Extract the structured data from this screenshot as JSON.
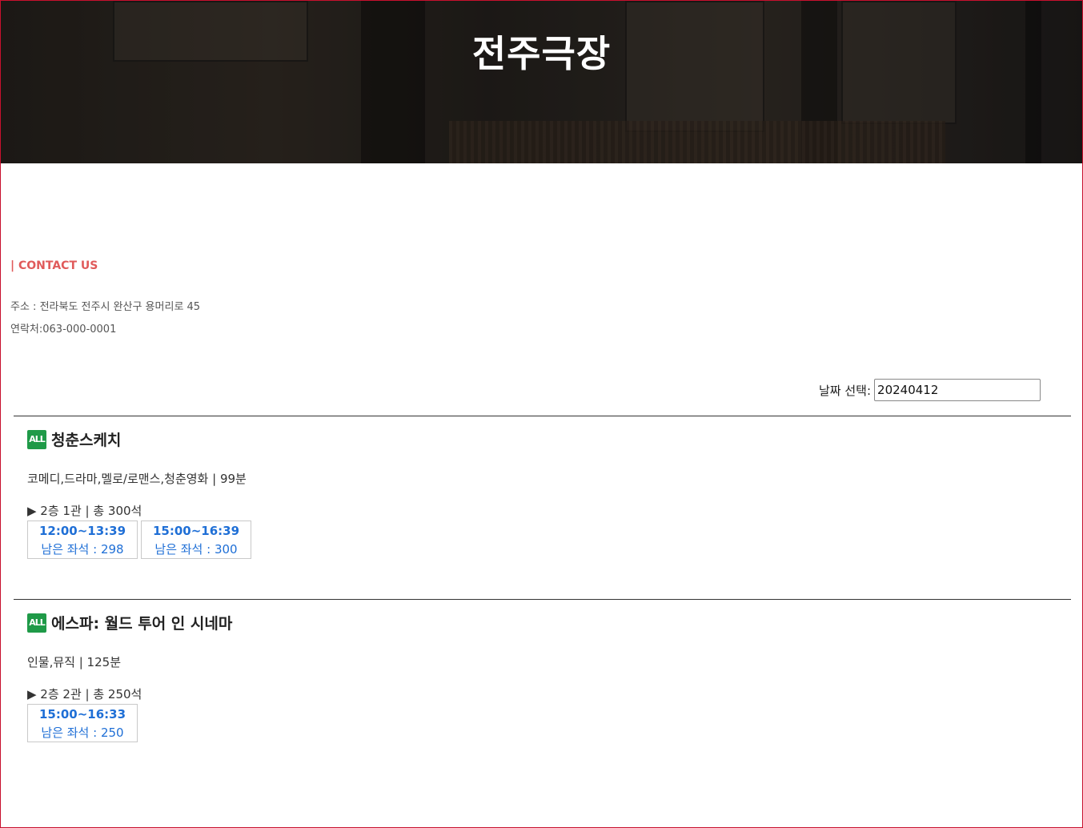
{
  "header": {
    "title": "전주극장"
  },
  "contact": {
    "heading": "| CONTACT US",
    "address": "주소 : 전라북도 전주시 완산구 용머리로 45",
    "phone": "연락처:063-000-0001"
  },
  "date_picker": {
    "label": "날짜 선택:",
    "value": "20240412"
  },
  "movies": [
    {
      "rating": "ALL",
      "title": "청춘스케치",
      "genre": "코메디,드라마,멜로/로맨스,청춘영화 | 99분",
      "hall": "▶ 2층 1관 | 총 300석",
      "showtimes": [
        {
          "time": "12:00~13:39",
          "seats": "남은 좌석 : 298"
        },
        {
          "time": "15:00~16:39",
          "seats": "남은 좌석 : 300"
        }
      ]
    },
    {
      "rating": "ALL",
      "title": "에스파: 월드 투어 인 시네마",
      "genre": "인물,뮤직 | 125분",
      "hall": "▶ 2층 2관 | 총 250석",
      "showtimes": [
        {
          "time": "15:00~16:33",
          "seats": "남은 좌석 : 250"
        }
      ]
    }
  ],
  "colors": {
    "accent": "#e05a5a",
    "time_blue": "#1f6fd6",
    "rating_green": "#1f9a48",
    "border": "#c8102e"
  }
}
